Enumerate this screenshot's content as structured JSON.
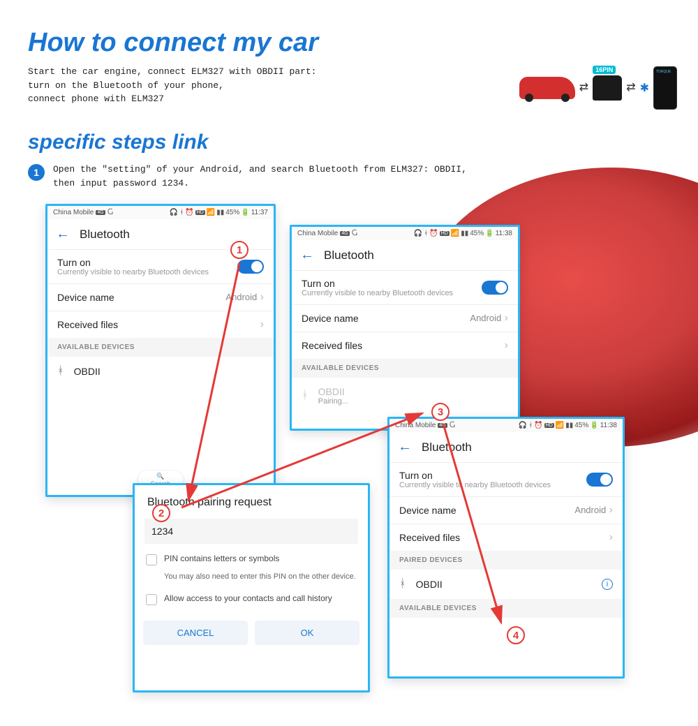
{
  "title1": "How to connect my car",
  "intro_l1": "Start the car engine, connect ELM327 with OBDII part:",
  "intro_l2": "turn on the Bluetooth of your phone,",
  "intro_l3": "connect phone with ELM327",
  "diagram": {
    "pin_label": "16PIN"
  },
  "title2": "specific steps link",
  "step1_num": "1",
  "step1_text": "Open the \"setting\" of your Android, and search Bluetooth from ELM327: OBDII, then input password 1234.",
  "status": {
    "carrier": "China Mobile",
    "hd": "HD",
    "battery": "45%",
    "time1": "11:37",
    "time2": "11:38"
  },
  "bt": {
    "title": "Bluetooth",
    "turn_on": "Turn on",
    "turn_on_sub": "Currently visible to nearby Bluetooth devices",
    "device_name": "Device name",
    "device_val": "Android",
    "received": "Received files",
    "available": "AVAILABLE DEVICES",
    "paired": "PAIRED DEVICES",
    "obdii": "OBDII",
    "pairing": "Pairing...",
    "search": "Search"
  },
  "dialog": {
    "title": "Bluetooth pairing request",
    "pin": "1234",
    "check1": "PIN contains letters or symbols",
    "note": "You may also need to enter this PIN on the other device.",
    "check2": "Allow access to your contacts and call history",
    "cancel": "CANCEL",
    "ok": "OK"
  },
  "marks": {
    "m1": "1",
    "m2": "2",
    "m3": "3",
    "m4": "4"
  }
}
